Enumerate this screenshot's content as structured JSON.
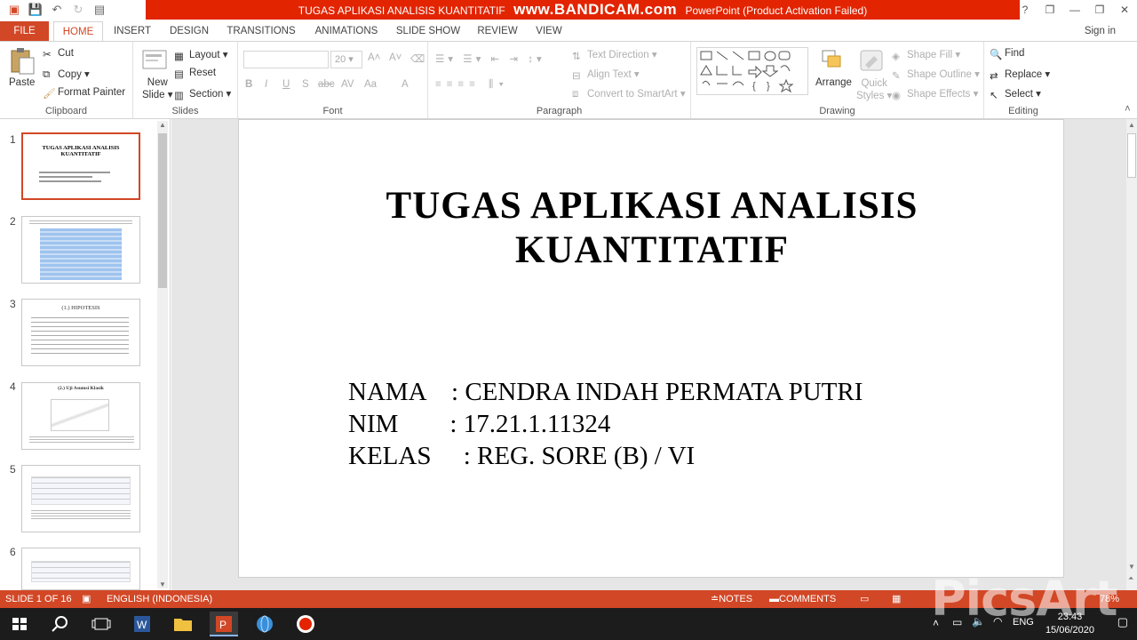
{
  "window": {
    "title_text": "TUGAS APLIKASI ANALISIS KUANTITATIF",
    "title_suffix": "PowerPoint (Product Activation Failed)",
    "recorder_watermark": "www.BANDICAM.com",
    "controls": [
      "?",
      "❐",
      "—",
      "❐",
      "✕"
    ]
  },
  "tabs": {
    "file": "FILE",
    "home": "HOME",
    "insert": "INSERT",
    "design": "DESIGN",
    "transitions": "TRANSITIONS",
    "animations": "ANIMATIONS",
    "slideshow": "SLIDE SHOW",
    "review": "REVIEW",
    "view": "VIEW",
    "signin": "Sign in"
  },
  "ribbon": {
    "clipboard": {
      "label": "Clipboard",
      "paste": "Paste",
      "cut": "Cut",
      "copy": "Copy",
      "format_painter": "Format Painter"
    },
    "slides": {
      "label": "Slides",
      "new_slide_1": "New",
      "new_slide_2": "Slide",
      "layout": "Layout",
      "reset": "Reset",
      "section": "Section"
    },
    "font": {
      "label": "Font",
      "size": "20",
      "bold": "B",
      "italic": "I",
      "underline": "U",
      "shadow": "S",
      "strike": "abc",
      "spacing": "AV",
      "case": "Aa",
      "color": "A"
    },
    "paragraph": {
      "label": "Paragraph",
      "text_direction": "Text Direction",
      "align_text": "Align Text",
      "convert_smartart": "Convert to SmartArt"
    },
    "drawing": {
      "label": "Drawing",
      "arrange": "Arrange",
      "quick_styles_1": "Quick",
      "quick_styles_2": "Styles",
      "shape_fill": "Shape Fill",
      "shape_outline": "Shape Outline",
      "shape_effects": "Shape Effects"
    },
    "editing": {
      "label": "Editing",
      "find": "Find",
      "replace": "Replace",
      "select": "Select"
    }
  },
  "thumbnails": [
    {
      "num": "1",
      "title": "TUGAS APLIKASI ANALISIS KUANTITATIF"
    },
    {
      "num": "2",
      "title": ""
    },
    {
      "num": "3",
      "title": "(1.) HIPOTESIS"
    },
    {
      "num": "4",
      "title": "(2.) Uji Asumsi Klasik"
    },
    {
      "num": "5",
      "title": ""
    },
    {
      "num": "6",
      "title": ""
    }
  ],
  "slide": {
    "title_line1": "TUGAS APLIKASI ANALISIS",
    "title_line2": "KUANTITATIF",
    "line_nama": "NAMA    : CENDRA INDAH PERMATA PUTRI",
    "line_nim": "NIM        : 17.21.1.11324",
    "line_kelas": "KELAS     : REG. SORE (B) / VI"
  },
  "status": {
    "slide_of": "SLIDE 1 OF 16",
    "language": "ENGLISH (INDONESIA)",
    "notes": "NOTES",
    "comments": "COMMENTS",
    "zoom": "78%"
  },
  "taskbar": {
    "lang": "ENG",
    "time": "23:43",
    "date": "15/06/2020"
  },
  "overlay_watermark": "PicsArt",
  "colors": {
    "accent": "#d24726",
    "title_red": "#e22400"
  }
}
